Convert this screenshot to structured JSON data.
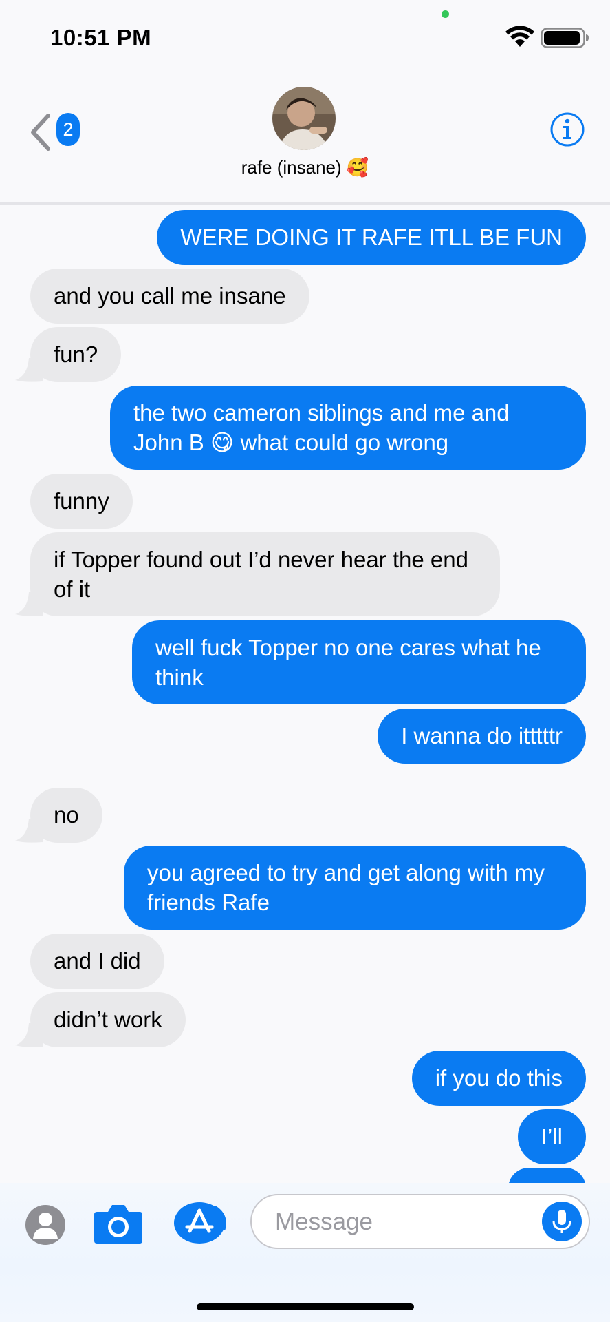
{
  "status_bar": {
    "time": "10:51 PM"
  },
  "header": {
    "back_badge": "2",
    "contact_name": "rafe (insane) 🥰"
  },
  "messages": [
    {
      "from": "me",
      "text": "WERE DOING IT RAFE ITLL BE FUN"
    },
    {
      "from": "them",
      "text": "and you call me insane"
    },
    {
      "from": "them",
      "text": "fun?"
    },
    {
      "from": "me",
      "text": "the two cameron siblings and me and John B 😋 what could go wrong"
    },
    {
      "from": "them",
      "text": "funny"
    },
    {
      "from": "them",
      "text": "if Topper found out I’d never hear the end of it"
    },
    {
      "from": "me",
      "text": "well fuck Topper no one cares what he think"
    },
    {
      "from": "me",
      "text": "I wanna do itttttr"
    },
    {
      "from": "them",
      "text": "no"
    },
    {
      "from": "me",
      "text": "you agreed to try and get along with my friends Rafe"
    },
    {
      "from": "them",
      "text": "and I did"
    },
    {
      "from": "them",
      "text": "didn’t work"
    },
    {
      "from": "me",
      "text": "if you do this"
    },
    {
      "from": "me",
      "text": "I’ll"
    }
  ],
  "input": {
    "placeholder": "Message"
  },
  "colors": {
    "accent": "#0a7bf2",
    "incoming_bubble": "#e9e9eb",
    "background": "#f9f9fb"
  },
  "icons": [
    "wifi-icon",
    "battery-icon",
    "back-chevron-icon",
    "info-icon",
    "contact-avatar-icon",
    "camera-icon",
    "app-store-icon",
    "microphone-icon"
  ]
}
